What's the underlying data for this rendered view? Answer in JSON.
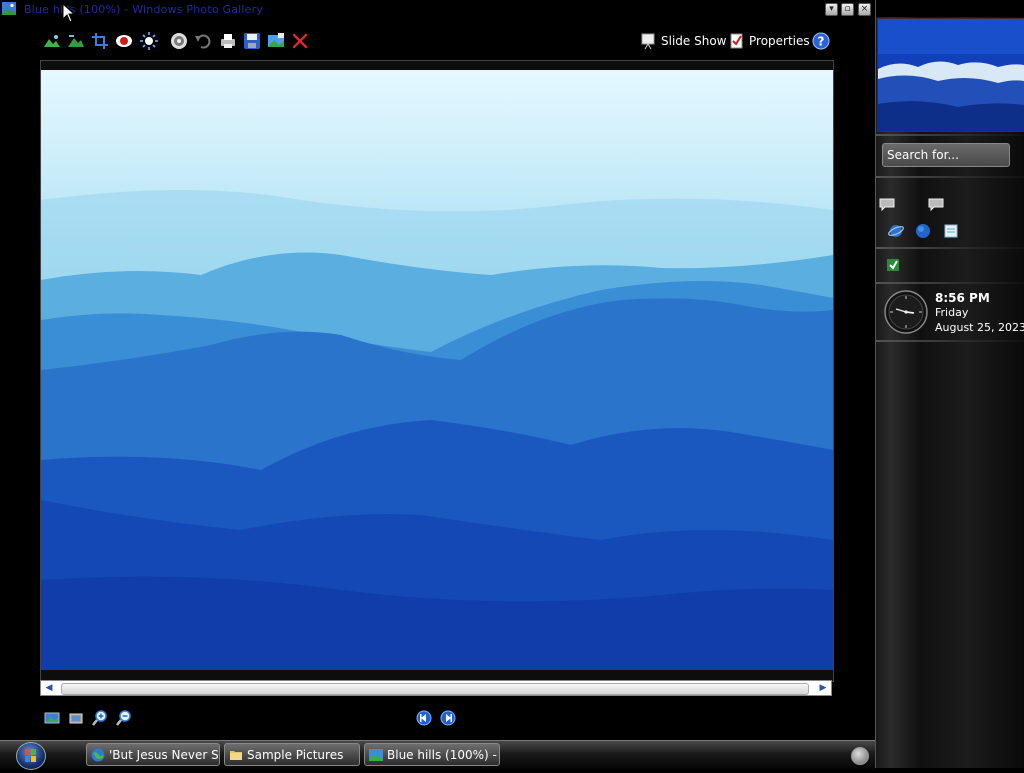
{
  "window": {
    "title": "Blue hills (100%) - Windows Photo Gallery"
  },
  "toolbar": {
    "slideshow_label": "Slide Show",
    "properties_label": "Properties",
    "icons": [
      "landscape-icon",
      "landscape-alt-icon",
      "crop-icon",
      "red-eye-icon",
      "brightness-icon",
      "auto-fix-icon",
      "undo-icon",
      "print-icon",
      "save-icon",
      "wallpaper-icon",
      "delete-icon",
      "help-icon"
    ]
  },
  "image": {
    "name": "Blue hills",
    "zoom": "100%"
  },
  "bottombar": {
    "icons": [
      "best-fit-icon",
      "actual-size-icon",
      "zoom-in-icon",
      "zoom-out-icon",
      "previous-icon",
      "next-icon"
    ]
  },
  "taskbar": {
    "items": [
      {
        "label": "'But Jesus Never S...",
        "icon": "globe-icon"
      },
      {
        "label": "Sample Pictures",
        "icon": "folder-icon"
      },
      {
        "label": "Blue hills (100%) - ...",
        "icon": "photo-gallery-icon"
      }
    ]
  },
  "sidebar": {
    "search_placeholder": "Search for...",
    "clock": {
      "time": "8:56 PM",
      "day": "Friday",
      "date": "August 25, 2023"
    }
  },
  "colors": {
    "title_text": "#1a2e9e",
    "photo_sky": "#cdeefa",
    "photo_deep": "#0d3fbb"
  }
}
